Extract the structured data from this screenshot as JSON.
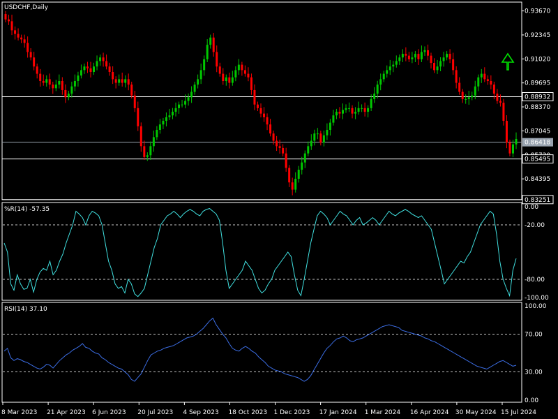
{
  "symbol_label": "USDCHF,Daily",
  "wpr_label": "%R(14) -57.35",
  "rsi_label": "RSI(14) 37.10",
  "colors": {
    "background": "#000000",
    "frame": "#ffffff",
    "bull": "#00c800",
    "bear": "#ff0000",
    "wpr_line": "#40e0e0",
    "rsi_line": "#3c6ee6",
    "level_line": "#ffffff",
    "bid_line": "#9aa4b0",
    "arrow": "#00e000"
  },
  "arrow_icon": "arrow-up-icon",
  "chart_data": [
    {
      "type": "candlestick",
      "title": "USDCHF,Daily",
      "price_ticks": [
        "0.93670",
        "0.92345",
        "0.91020",
        "0.89695",
        "0.88370",
        "0.87045",
        "0.85720",
        "0.84395"
      ],
      "price_tick_values": [
        0.9367,
        0.92345,
        0.9102,
        0.89695,
        0.8837,
        0.87045,
        0.8572,
        0.84395
      ],
      "ylim": [
        0.8332,
        0.9408
      ],
      "price_labels": [
        {
          "text": "0.88932",
          "value": 0.88932,
          "style": "boxed"
        },
        {
          "text": "0.86418",
          "value": 0.86418,
          "style": "highlight"
        },
        {
          "text": "0.85495",
          "value": 0.85495,
          "style": "boxed"
        },
        {
          "text": "0.83251",
          "value": 0.83251,
          "style": "boxed"
        }
      ],
      "horizontal_levels": [
        0.88932,
        0.85495,
        0.83251
      ],
      "bid_level": 0.86418,
      "x_dates": [
        "8 Mar 2023",
        "21 Apr 2023",
        "6 Jun 2023",
        "20 Jul 2023",
        "4 Sep 2023",
        "18 Oct 2023",
        "1 Dec 2023",
        "17 Jan 2024",
        "1 Mar 2024",
        "16 Apr 2024",
        "30 May 2024",
        "15 Jul 2024"
      ],
      "closes": [
        0.932,
        0.931,
        0.926,
        0.924,
        0.922,
        0.921,
        0.919,
        0.914,
        0.911,
        0.906,
        0.902,
        0.898,
        0.897,
        0.899,
        0.896,
        0.894,
        0.896,
        0.898,
        0.893,
        0.889,
        0.891,
        0.895,
        0.898,
        0.901,
        0.904,
        0.906,
        0.905,
        0.903,
        0.906,
        0.909,
        0.911,
        0.909,
        0.906,
        0.903,
        0.899,
        0.897,
        0.899,
        0.897,
        0.899,
        0.896,
        0.89,
        0.883,
        0.873,
        0.862,
        0.856,
        0.857,
        0.862,
        0.867,
        0.871,
        0.874,
        0.876,
        0.878,
        0.879,
        0.881,
        0.883,
        0.885,
        0.885,
        0.887,
        0.889,
        0.892,
        0.896,
        0.899,
        0.904,
        0.91,
        0.918,
        0.922,
        0.914,
        0.906,
        0.902,
        0.898,
        0.9,
        0.897,
        0.9,
        0.904,
        0.907,
        0.904,
        0.902,
        0.9,
        0.893,
        0.885,
        0.883,
        0.88,
        0.878,
        0.874,
        0.869,
        0.865,
        0.862,
        0.861,
        0.858,
        0.85,
        0.842,
        0.838,
        0.844,
        0.849,
        0.853,
        0.858,
        0.862,
        0.865,
        0.869,
        0.869,
        0.864,
        0.868,
        0.871,
        0.875,
        0.879,
        0.881,
        0.88,
        0.882,
        0.883,
        0.883,
        0.88,
        0.881,
        0.883,
        0.883,
        0.881,
        0.883,
        0.888,
        0.891,
        0.896,
        0.899,
        0.902,
        0.904,
        0.906,
        0.907,
        0.909,
        0.911,
        0.913,
        0.912,
        0.91,
        0.911,
        0.913,
        0.91,
        0.914,
        0.915,
        0.912,
        0.908,
        0.904,
        0.906,
        0.909,
        0.911,
        0.913,
        0.91,
        0.904,
        0.897,
        0.892,
        0.888,
        0.888,
        0.889,
        0.89,
        0.895,
        0.9,
        0.902,
        0.899,
        0.898,
        0.896,
        0.891,
        0.887,
        0.886,
        0.876,
        0.864,
        0.858,
        0.863,
        0.866
      ],
      "series": [
        {
          "name": "%R(14)",
          "ylim": [
            -100,
            0
          ],
          "ticks": [
            0,
            -20,
            -80,
            -100
          ],
          "tick_labels": [
            "0.00",
            "-20.00",
            "-80.00",
            "-100.00"
          ],
          "levels": [
            -20,
            -80
          ],
          "values": [
            -40,
            -50,
            -85,
            -92,
            -75,
            -85,
            -91,
            -90,
            -80,
            -94,
            -80,
            -72,
            -68,
            -70,
            -60,
            -75,
            -70,
            -60,
            -52,
            -40,
            -30,
            -20,
            -5,
            -8,
            -12,
            -20,
            -10,
            -5,
            -7,
            -10,
            -20,
            -40,
            -60,
            -70,
            -85,
            -90,
            -88,
            -95,
            -80,
            -85,
            -96,
            -99,
            -95,
            -90,
            -75,
            -60,
            -45,
            -35,
            -20,
            -15,
            -10,
            -8,
            -5,
            -8,
            -12,
            -8,
            -5,
            -3,
            -5,
            -8,
            -10,
            -5,
            -3,
            -2,
            -5,
            -8,
            -15,
            -40,
            -70,
            -90,
            -85,
            -80,
            -75,
            -70,
            -60,
            -65,
            -70,
            -80,
            -90,
            -95,
            -92,
            -85,
            -80,
            -70,
            -65,
            -60,
            -55,
            -50,
            -55,
            -75,
            -92,
            -98,
            -80,
            -60,
            -40,
            -25,
            -10,
            -5,
            -8,
            -12,
            -20,
            -15,
            -10,
            -5,
            -8,
            -10,
            -15,
            -20,
            -15,
            -12,
            -20,
            -18,
            -15,
            -12,
            -15,
            -20,
            -15,
            -10,
            -5,
            -8,
            -10,
            -7,
            -5,
            -3,
            -5,
            -8,
            -10,
            -12,
            -10,
            -15,
            -20,
            -25,
            -40,
            -55,
            -70,
            -85,
            -80,
            -75,
            -70,
            -65,
            -60,
            -62,
            -55,
            -50,
            -40,
            -30,
            -20,
            -15,
            -10,
            -5,
            -8,
            -30,
            -60,
            -80,
            -90,
            -98,
            -70,
            -57
          ]
        },
        {
          "name": "RSI(14)",
          "ylim": [
            0,
            100
          ],
          "ticks": [
            100,
            70,
            30,
            0
          ],
          "tick_labels": [
            "100.00",
            "70.00",
            "30.00",
            "0.00"
          ],
          "levels": [
            70,
            30
          ],
          "values": [
            52,
            55,
            45,
            42,
            44,
            43,
            41,
            40,
            38,
            36,
            34,
            33,
            35,
            38,
            37,
            34,
            38,
            42,
            45,
            48,
            50,
            53,
            55,
            57,
            60,
            56,
            55,
            52,
            50,
            49,
            45,
            43,
            40,
            38,
            36,
            34,
            33,
            30,
            27,
            22,
            20,
            24,
            28,
            35,
            42,
            48,
            50,
            52,
            53,
            55,
            56,
            57,
            58,
            60,
            62,
            64,
            66,
            67,
            68,
            70,
            73,
            76,
            80,
            84,
            87,
            80,
            75,
            70,
            66,
            60,
            55,
            53,
            52,
            55,
            57,
            55,
            52,
            50,
            46,
            43,
            40,
            36,
            34,
            32,
            31,
            30,
            28,
            27,
            26,
            25,
            24,
            22,
            20,
            22,
            26,
            32,
            38,
            44,
            50,
            55,
            58,
            62,
            65,
            66,
            68,
            66,
            63,
            62,
            64,
            65,
            66,
            68,
            70,
            72,
            74,
            76,
            78,
            79,
            80,
            79,
            78,
            77,
            74,
            73,
            72,
            71,
            70,
            69,
            68,
            66,
            65,
            63,
            62,
            60,
            58,
            56,
            54,
            52,
            50,
            48,
            46,
            44,
            42,
            40,
            38,
            36,
            35,
            34,
            33,
            35,
            37,
            39,
            41,
            42,
            40,
            38,
            36,
            37
          ],
          "values_note_removed": true
        }
      ]
    }
  ]
}
